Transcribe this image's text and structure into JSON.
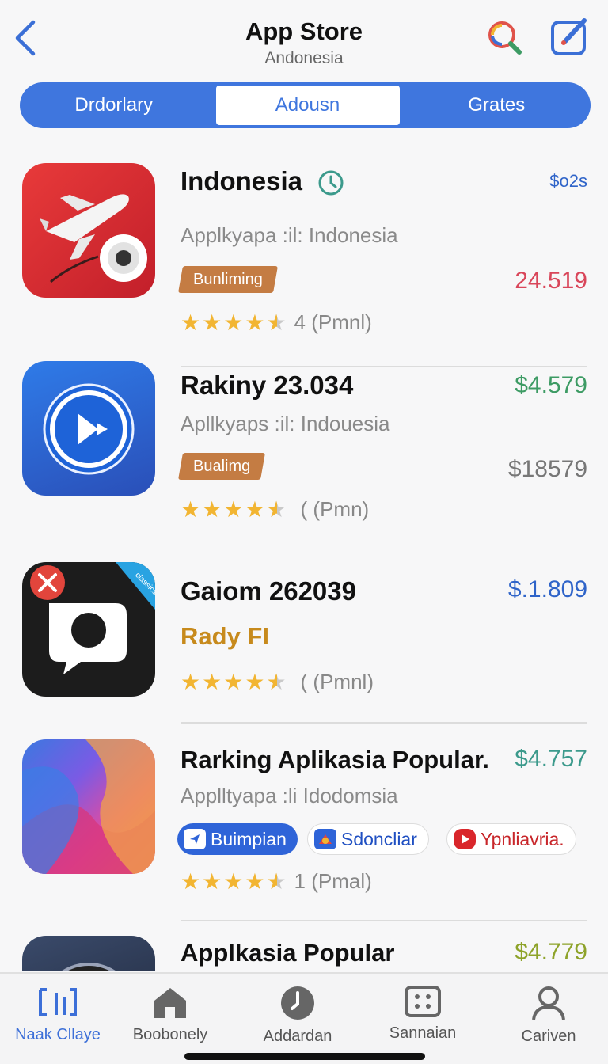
{
  "header": {
    "title": "App Store",
    "subtitle": "Andonesia"
  },
  "segments": [
    {
      "label": "Drdorlary",
      "active": false
    },
    {
      "label": "Adousn",
      "active": true
    },
    {
      "label": "Grates",
      "active": false
    }
  ],
  "apps": [
    {
      "name": "Indonesia",
      "subtitle": "Applkyapa :il: Indonesia",
      "price_top": "$o2s",
      "price": "24.519",
      "tag": "Bunliming",
      "rating_text": "4 (Pmnl)",
      "icon": "airplane-speaker-icon"
    },
    {
      "name": "Rakiny 23.034",
      "subtitle": "Apllkyaps :il: Indouesia",
      "price": "$4.579",
      "price_secondary": "$18579",
      "tag": "Bualimg",
      "rating_text": "( (Pmn)",
      "icon": "play-circle-icon"
    },
    {
      "name": "Gaiom 262039",
      "subtitle": "Rady FI",
      "price": "$.1.809",
      "rating_text": "( (Pmnl)",
      "icon": "camera-chat-icon",
      "badge_text": "classics"
    },
    {
      "name": "Rarking Aplikasia Popular.",
      "subtitle": "Applltyapa :li Idodomsia",
      "price": "$4.757",
      "rating_text": "1 (Pmal)",
      "icon": "gradient-wave-icon",
      "chips": [
        {
          "label": "Buimpian",
          "icon": "send-icon"
        },
        {
          "label": "Sdoncliar",
          "icon": "logo-icon"
        },
        {
          "label": "Ypnliavria.",
          "icon": "play-icon"
        }
      ]
    },
    {
      "name": "Applkasia Popular",
      "price": "$4.779",
      "icon": "camera-lens-icon"
    }
  ],
  "tabbar": [
    {
      "label": "Naak Cllaye",
      "icon": "bars-icon",
      "active": true
    },
    {
      "label": "Boobonely",
      "icon": "house-icon",
      "active": false
    },
    {
      "label": "Addardan",
      "icon": "clock-icon",
      "active": false
    },
    {
      "label": "Sannaian",
      "icon": "grid-icon",
      "active": false
    },
    {
      "label": "Cariven",
      "icon": "person-icon",
      "active": false
    }
  ],
  "colors": {
    "accent": "#3f76de",
    "tag": "#c47c43",
    "price_red": "#d9465a",
    "price_green": "#3d9b64",
    "price_blue": "#2f64c9",
    "price_teal": "#3c9a8c",
    "price_olive": "#8ea32a",
    "star": "#f2b532"
  }
}
